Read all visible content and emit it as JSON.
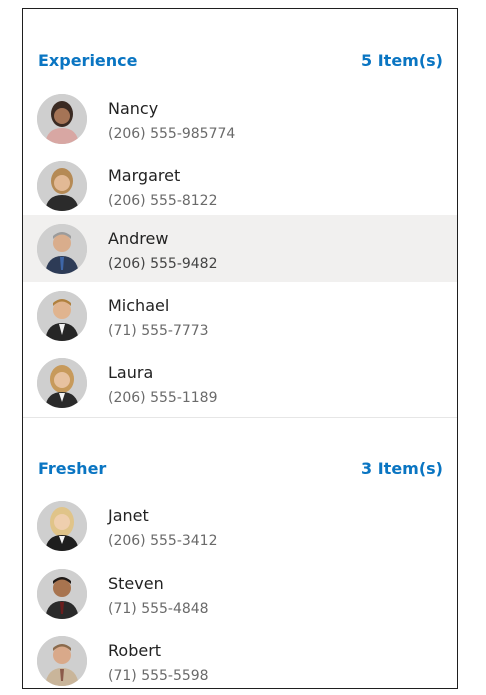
{
  "groups": [
    {
      "title": "Experience",
      "count": "5 Item(s)",
      "items": [
        {
          "name": "Nancy",
          "phone": "(206) 555-985774",
          "avatar": "female-avatar"
        },
        {
          "name": "Margaret",
          "phone": "(206) 555-8122",
          "avatar": "female-avatar"
        },
        {
          "name": "Andrew",
          "phone": "(206) 555-9482",
          "avatar": "male-avatar"
        },
        {
          "name": "Michael",
          "phone": "(71) 555-7773",
          "avatar": "male-avatar"
        },
        {
          "name": "Laura",
          "phone": "(206) 555-1189",
          "avatar": "female-avatar"
        }
      ]
    },
    {
      "title": "Fresher",
      "count": "3 Item(s)",
      "items": [
        {
          "name": "Janet",
          "phone": "(206) 555-3412",
          "avatar": "female-avatar"
        },
        {
          "name": "Steven",
          "phone": "(71) 555-4848",
          "avatar": "male-avatar"
        },
        {
          "name": "Robert",
          "phone": "(71) 555-5598",
          "avatar": "male-avatar"
        }
      ]
    }
  ],
  "selected_item": "Andrew",
  "colors": {
    "header_text": "#0a75c2",
    "selected_background": "#f1f0ef",
    "avatar_background": "#c9c9c9"
  }
}
